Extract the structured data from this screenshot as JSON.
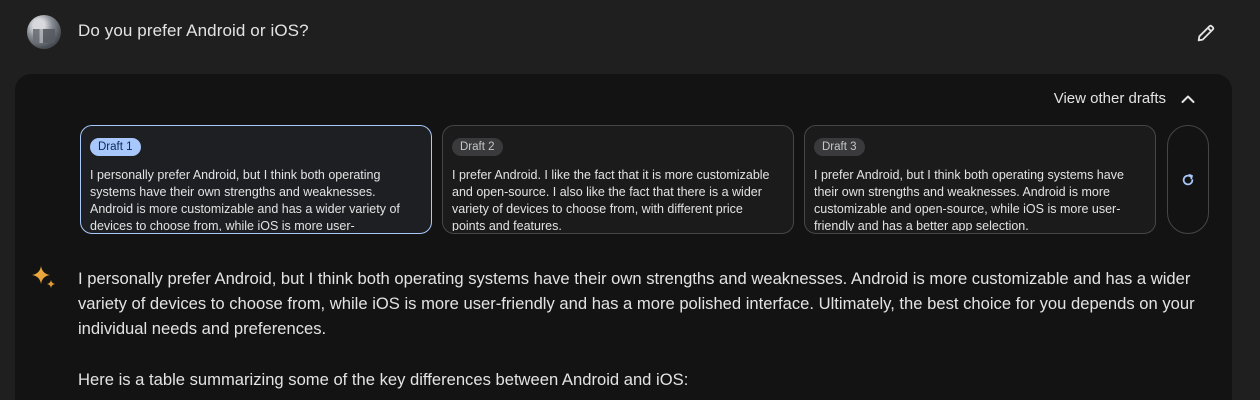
{
  "prompt": {
    "text": "Do you prefer Android or iOS?"
  },
  "drafts_header": {
    "label": "View other drafts"
  },
  "drafts": [
    {
      "badge": "Draft 1",
      "text": "I personally prefer Android, but I think both operating systems have their own strengths and weaknesses. Android is more customizable and has a wider variety of devices to choose from, while iOS is more user-",
      "selected": true
    },
    {
      "badge": "Draft 2",
      "text": "I prefer Android. I like the fact that it is more customizable and open-source. I also like the fact that there is a wider variety of devices to choose from, with different price points and features.",
      "selected": false
    },
    {
      "badge": "Draft 3",
      "text": "I prefer Android, but I think both operating systems have their own strengths and weaknesses. Android is more customizable and open-source, while iOS is more user-friendly and has a better app selection.",
      "selected": false
    }
  ],
  "response": {
    "paragraph1": "I personally prefer Android, but I think both operating systems have their own strengths and weaknesses. Android is more customizable and has a wider variety of devices to choose from, while iOS is more user-friendly and has a more polished interface. Ultimately, the best choice for you depends on your individual needs and preferences.",
    "paragraph2": "Here is a table summarizing some of the key differences between Android and iOS:"
  },
  "colors": {
    "background": "#1f1f1f",
    "panel": "#131314",
    "accent": "#a8c7fa",
    "text": "#e3e3e3"
  },
  "icons": {
    "avatar": "user-avatar",
    "edit": "pencil-icon",
    "collapse": "chevron-up-icon",
    "regenerate": "refresh-icon",
    "assistant": "sparkle-icon"
  }
}
